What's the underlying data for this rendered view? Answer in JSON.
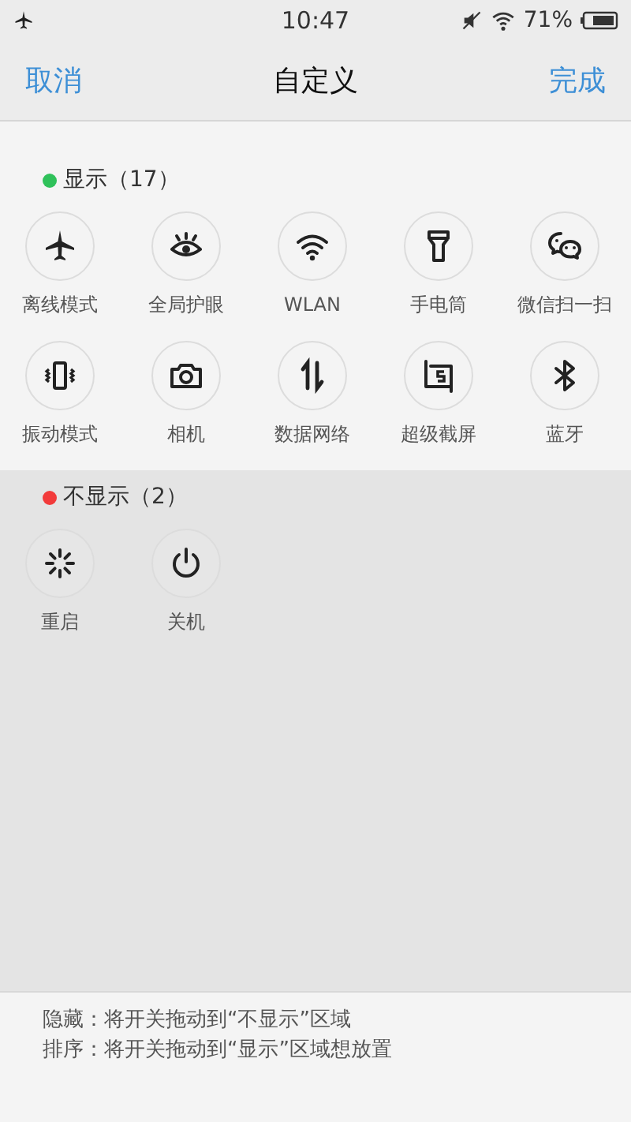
{
  "status_bar": {
    "time": "10:47",
    "battery": "71%"
  },
  "nav": {
    "cancel": "取消",
    "title": "自定义",
    "done": "完成"
  },
  "sections": [
    {
      "title": "显示（17）",
      "color": "#2fc15a",
      "kind": "shown",
      "items": [
        {
          "label": "离线模式",
          "kind": "airplane"
        },
        {
          "label": "全局护眼",
          "kind": "eye"
        },
        {
          "label": "WLAN",
          "kind": "wifi"
        },
        {
          "label": "手电筒",
          "kind": "flashlight"
        },
        {
          "label": "微信扫一扫",
          "kind": "chat"
        },
        {
          "label": "振动模式",
          "kind": "vibrate"
        },
        {
          "label": "相机",
          "kind": "camera"
        },
        {
          "label": "数据网络",
          "kind": "data"
        },
        {
          "label": "超级截屏",
          "kind": "screenshot"
        },
        {
          "label": "蓝牙",
          "kind": "bluetooth"
        }
      ]
    },
    {
      "title": "不显示（2）",
      "color": "#f23b3b",
      "kind": "hidden",
      "items": [
        {
          "label": "重启",
          "kind": "restart"
        },
        {
          "label": "关机",
          "kind": "power"
        }
      ]
    }
  ],
  "tips": [
    "隐藏：将开关拖动到“不显示”区域",
    "排序：将开关拖动到“显示”区域想放置"
  ]
}
